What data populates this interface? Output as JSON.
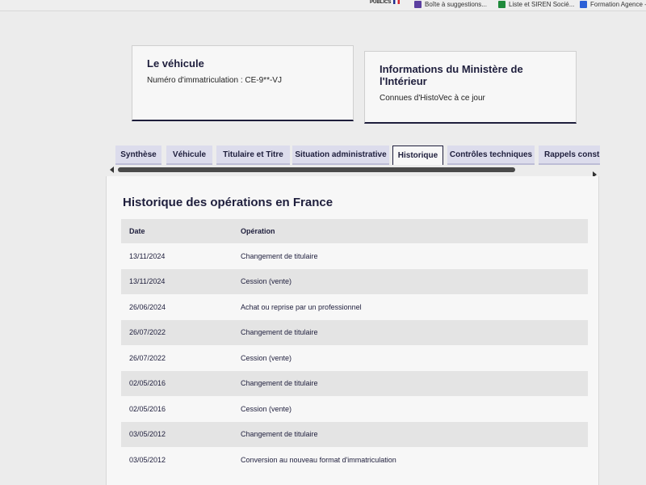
{
  "bookmarks": {
    "items": [
      {
        "label": "Boîte à suggestions...",
        "icon": "document-icon",
        "color": "#5b3fa0"
      },
      {
        "label": "Liste et SIREN Socié...",
        "icon": "spreadsheet-icon",
        "color": "#1f8a3b"
      },
      {
        "label": "Formation Agence -...",
        "icon": "doc-icon",
        "color": "#2b5fd6"
      }
    ],
    "logo_text": "PUBLICS"
  },
  "vehicule_card": {
    "title": "Le véhicule",
    "plate_text": "Numéro d'immatriculation : CE-9**-VJ"
  },
  "ministere_card": {
    "title": "Informations du Ministère de l'Intérieur",
    "subtitle": "Connues d'HistoVec à ce jour"
  },
  "tabs": [
    {
      "label": "Synthèse",
      "active": false
    },
    {
      "label": "Véhicule",
      "active": false
    },
    {
      "label": "Titulaire et Titre",
      "active": false
    },
    {
      "label": "Situation administrative",
      "active": false
    },
    {
      "label": "Historique",
      "active": true
    },
    {
      "label": "Contrôles techniques",
      "active": false
    },
    {
      "label": "Rappels constru",
      "active": false
    }
  ],
  "history": {
    "title": "Historique des opérations en France",
    "columns": {
      "date": "Date",
      "operation": "Opération"
    },
    "rows": [
      {
        "date": "13/11/2024",
        "operation": "Changement de titulaire"
      },
      {
        "date": "13/11/2024",
        "operation": "Cession (vente)"
      },
      {
        "date": "26/06/2024",
        "operation": "Achat ou reprise par un professionnel"
      },
      {
        "date": "26/07/2022",
        "operation": "Changement de titulaire"
      },
      {
        "date": "26/07/2022",
        "operation": "Cession (vente)"
      },
      {
        "date": "02/05/2016",
        "operation": "Changement de titulaire"
      },
      {
        "date": "02/05/2016",
        "operation": "Cession (vente)"
      },
      {
        "date": "03/05/2012",
        "operation": "Changement de titulaire"
      },
      {
        "date": "03/05/2012",
        "operation": "Conversion au nouveau format d'immatriculation"
      }
    ]
  }
}
